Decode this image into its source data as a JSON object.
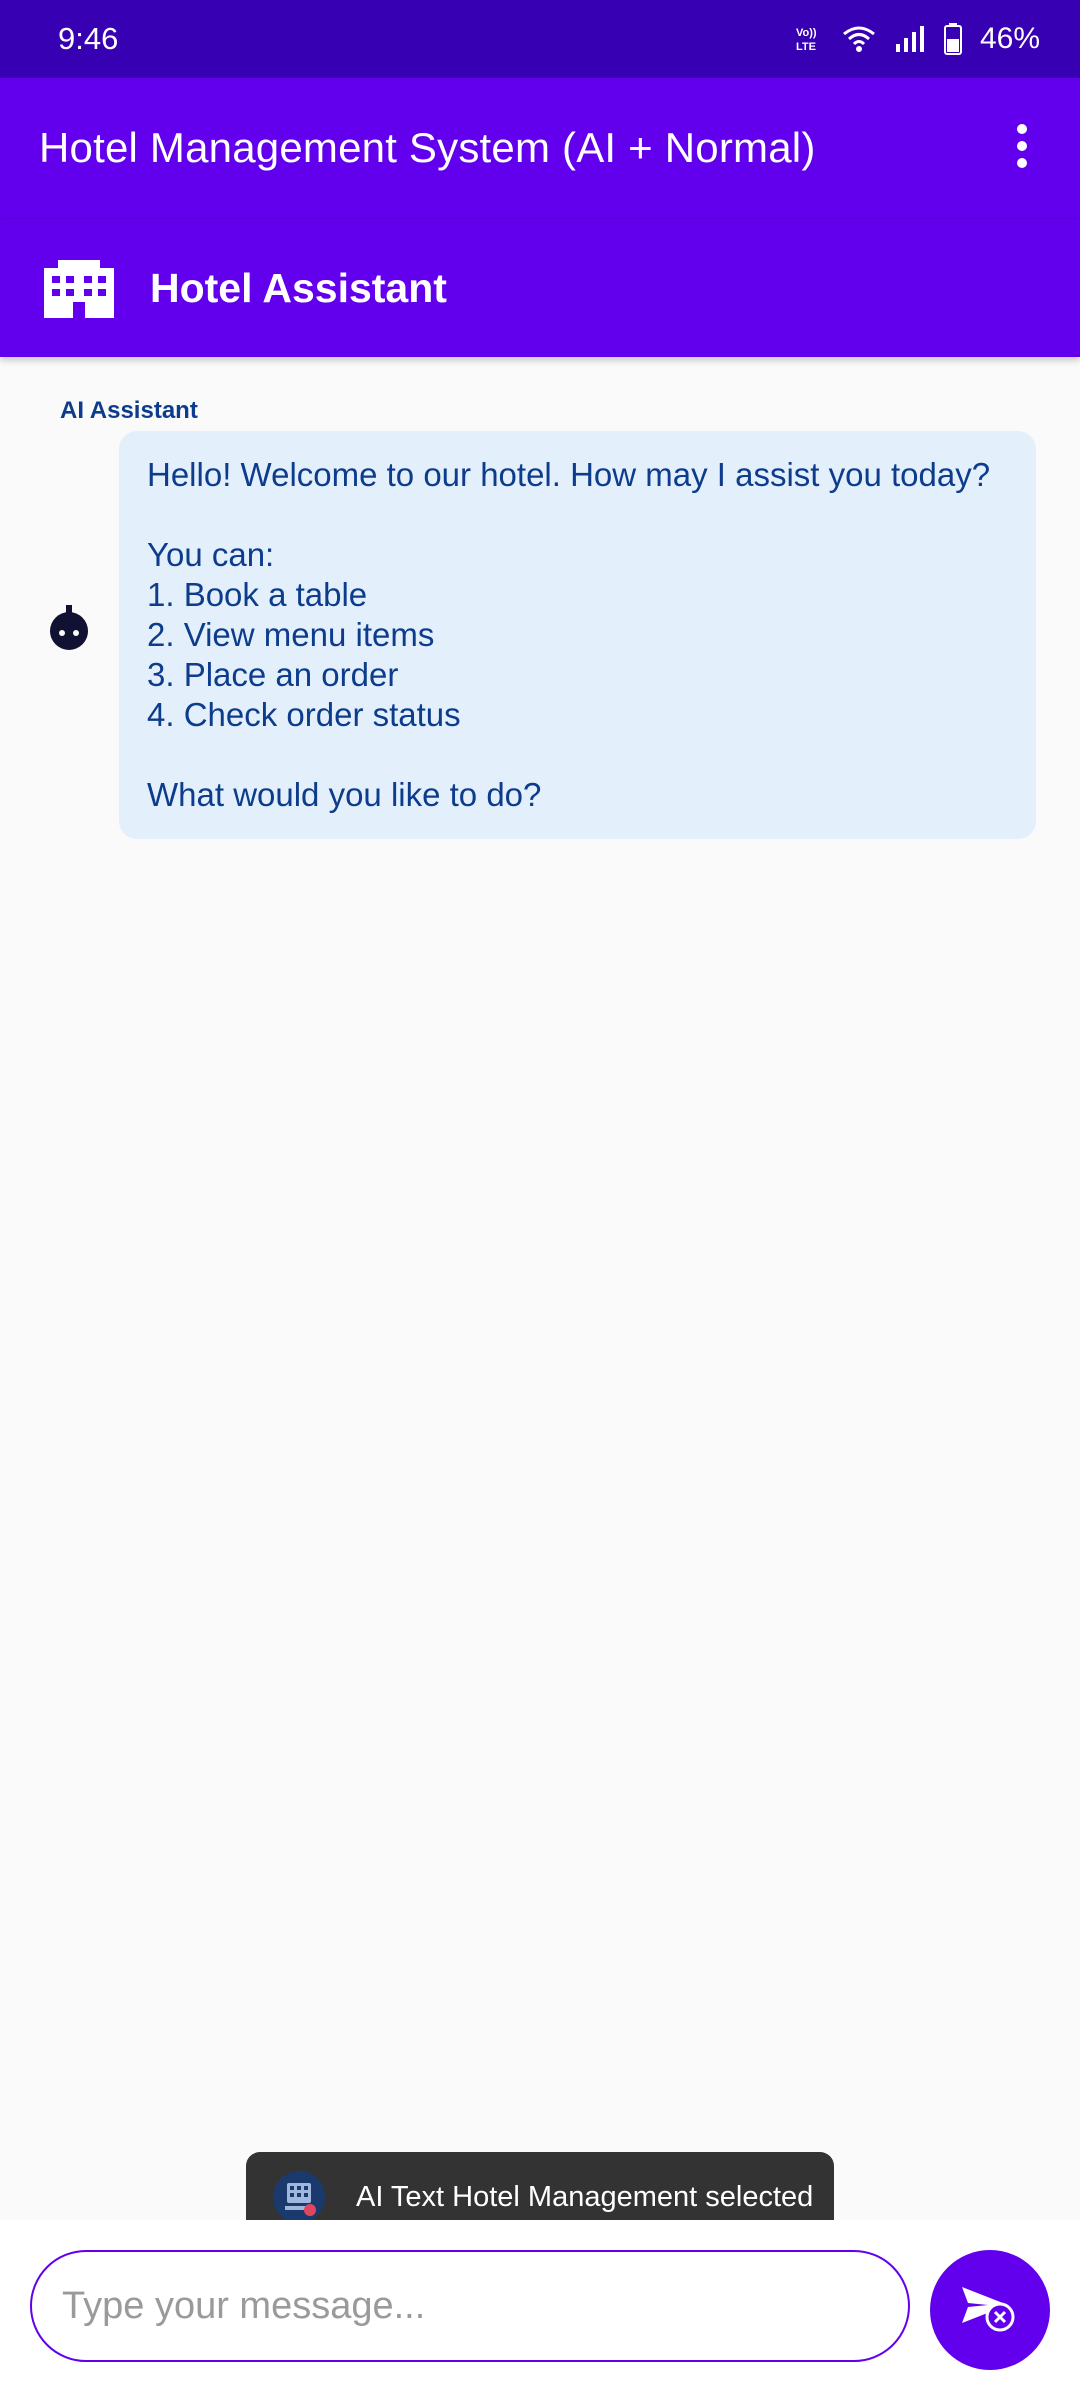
{
  "status_bar": {
    "time": "9:46",
    "battery": "46%",
    "icons": [
      "volte-icon",
      "wifi-icon",
      "signal-icon",
      "battery-icon"
    ]
  },
  "app_bar": {
    "title": "Hotel Management System (AI + Normal)",
    "menu_icon": "more-vert-icon"
  },
  "assistant_header": {
    "icon": "hotel-building-icon",
    "title": "Hotel Assistant"
  },
  "chat": {
    "messages": [
      {
        "sender": "AI Assistant",
        "avatar_icon": "bot-icon",
        "text": "Hello! Welcome to our hotel. How may I assist you today?\n\nYou can:\n1. Book a table\n2. View menu items\n3. Place an order\n4. Check order status\n\nWhat would you like to do?"
      }
    ]
  },
  "toast": {
    "icon": "app-icon",
    "text": "AI Text Hotel Management selected"
  },
  "input": {
    "placeholder": "Type your message...",
    "value": ""
  },
  "send_button": {
    "icon": "send-icon"
  },
  "colors": {
    "status_bar": "#3700b3",
    "primary": "#6200ee",
    "bubble_bg": "#e3f0fb",
    "bubble_text": "#0d3c8c",
    "toast_bg": "#333333"
  }
}
